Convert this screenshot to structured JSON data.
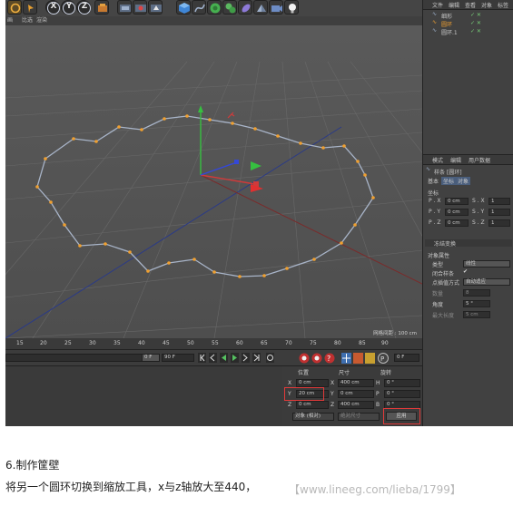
{
  "menu": {
    "items": [
      "画",
      "比选",
      "渲染"
    ]
  },
  "toolbar": {
    "x_label": "X",
    "y_label": "Y",
    "z_label": "Z"
  },
  "viewport": {
    "grid_label": "网格间距 : 100 cm"
  },
  "object_manager": {
    "menu": [
      "文件",
      "编辑",
      "查看",
      "对象",
      "标签"
    ],
    "items": [
      {
        "name": "细形",
        "checks": "✓ ✕"
      },
      {
        "name": "圆环",
        "checks": "✓ ✕"
      },
      {
        "name": "圆环.1",
        "checks": "✓ ✕"
      }
    ]
  },
  "attributes": {
    "menu": [
      "模式",
      "编辑",
      "用户数据"
    ],
    "object_title": "样条 [圆环]",
    "tabs": [
      "基本",
      "坐标",
      "对象"
    ],
    "coord_header": "坐标",
    "coords": [
      {
        "label": "P . X",
        "value": "0 cm",
        "label2": "S . X",
        "value2": "1"
      },
      {
        "label": "P . Y",
        "value": "0 cm",
        "label2": "S . Y",
        "value2": "1"
      },
      {
        "label": "P . Z",
        "value": "0 cm",
        "label2": "S . Z",
        "value2": "1"
      }
    ],
    "freeze_header": "冻结变换",
    "object_header": "对象属性",
    "type_label": "类型",
    "type_value": "线性",
    "closed_label": "闭合样条",
    "interp_label": "点插值方式",
    "interp_value": "自动适应",
    "count_label": "数量",
    "count_value": "8",
    "angle_label": "角度",
    "angle_value": "5 °",
    "maxlen_label": "最大长度",
    "maxlen_value": "5 cm"
  },
  "timeline": {
    "ticks": [
      "15",
      "20",
      "25",
      "30",
      "35",
      "40",
      "45",
      "50",
      "55",
      "60",
      "65",
      "70",
      "75",
      "80",
      "85",
      "90"
    ],
    "frame_a": "0 F",
    "frame_b": "90 F",
    "frame_c": "0 F"
  },
  "coords_panel": {
    "headers": [
      "位置",
      "尺寸",
      "旋转"
    ],
    "rows": [
      {
        "axis": "X",
        "pos": "0 cm",
        "axis2": "X",
        "size": "400 cm",
        "axis3": "H",
        "rot": "0 °"
      },
      {
        "axis": "Y",
        "pos": "20 cm",
        "axis2": "Y",
        "size": "0 cm",
        "axis3": "P",
        "rot": "0 °"
      },
      {
        "axis": "Z",
        "pos": "0 cm",
        "axis2": "Z",
        "size": "400 cm",
        "axis3": "B",
        "rot": "0 °"
      }
    ],
    "mode": "对象 (相对)",
    "size_mode": "绝对尺寸",
    "apply": "应用"
  },
  "article": {
    "heading": "6.制作筐壁",
    "body": "将另一个圆环切换到缩放工具，x与z轴放大至440，",
    "watermark": "【www.lineeg.com/lieba/1799】"
  },
  "colors": {
    "accent_red": "#e23a3a",
    "point_orange": "#f0a030",
    "spline_line": "#a8b4c8"
  }
}
